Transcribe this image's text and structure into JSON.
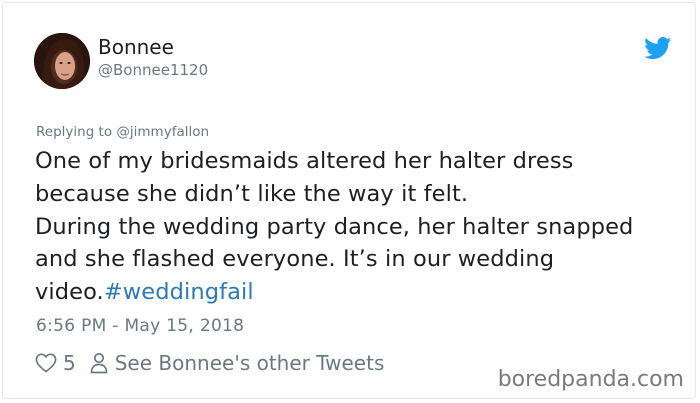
{
  "author": {
    "display_name": "Bonnee",
    "handle": "@Bonnee1120",
    "avatar_icon": "profile-photo"
  },
  "brand": {
    "logo_icon": "twitter-bird-icon",
    "logo_color": "#1da1f2"
  },
  "tweet": {
    "replying_prefix": "Replying to",
    "replying_to": "@jimmyfallon",
    "lines": [
      "One of my bridesmaids altered her halter dress",
      "because she didn’t like the way it felt.",
      "During the wedding party dance, her halter snapped",
      "and she flashed everyone. It’s in our wedding"
    ],
    "last_line_text": "video.",
    "hashtag": "#weddingfail",
    "timestamp": "6:56 PM - May 15, 2018"
  },
  "actions": {
    "like_icon": "heart-icon",
    "like_count": "5",
    "profile_icon": "person-icon",
    "other_tweets_label": "See Bonnee's other Tweets"
  },
  "watermark": "boredpanda.com",
  "colors": {
    "text": "#1c2022",
    "muted": "#697882",
    "link": "#2b7bb9",
    "border": "#e1e8ed"
  }
}
